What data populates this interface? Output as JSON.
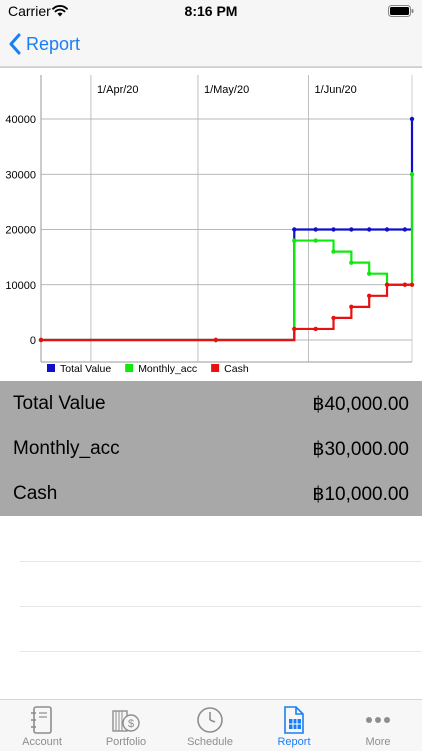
{
  "status": {
    "carrier": "Carrier",
    "time": "8:16 PM"
  },
  "nav": {
    "back_label": "Report"
  },
  "chart_data": {
    "type": "line",
    "x_tick_labels": [
      "1/Apr/20",
      "1/May/20",
      "1/Jun/20"
    ],
    "y_tick_labels": [
      "0",
      "10000",
      "20000",
      "30000",
      "40000"
    ],
    "ylim": [
      0,
      40000
    ],
    "grid": true,
    "legend_position": "bottom-left",
    "x": [
      "2020-03-18",
      "2020-05-06",
      "2020-05-28",
      "2020-06-03",
      "2020-06-08",
      "2020-06-13",
      "2020-06-18",
      "2020-06-23",
      "2020-06-28",
      "2020-06-30"
    ],
    "series": [
      {
        "name": "Total Value",
        "color": "#1010c8",
        "values": [
          0,
          0,
          20000,
          20000,
          20000,
          20000,
          20000,
          20000,
          20000,
          40000
        ]
      },
      {
        "name": "Monthly_acc",
        "color": "#10e810",
        "values": [
          0,
          0,
          18000,
          18000,
          16000,
          14000,
          12000,
          10000,
          10000,
          30000
        ]
      },
      {
        "name": "Cash",
        "color": "#e81010",
        "values": [
          0,
          0,
          2000,
          2000,
          4000,
          6000,
          8000,
          10000,
          10000,
          10000
        ]
      }
    ]
  },
  "summary": [
    {
      "label": "Total Value",
      "value": "฿40,000.00"
    },
    {
      "label": "Monthly_acc",
      "value": "฿30,000.00"
    },
    {
      "label": "Cash",
      "value": "฿10,000.00"
    }
  ],
  "tabs": [
    {
      "label": "Account",
      "icon": "notebook-icon"
    },
    {
      "label": "Portfolio",
      "icon": "money-icon"
    },
    {
      "label": "Schedule",
      "icon": "clock-icon"
    },
    {
      "label": "Report",
      "icon": "report-icon"
    },
    {
      "label": "More",
      "icon": "more-icon"
    }
  ],
  "colors": {
    "accent": "#1a7ef5",
    "summary_bg": "#a8a8a8"
  }
}
